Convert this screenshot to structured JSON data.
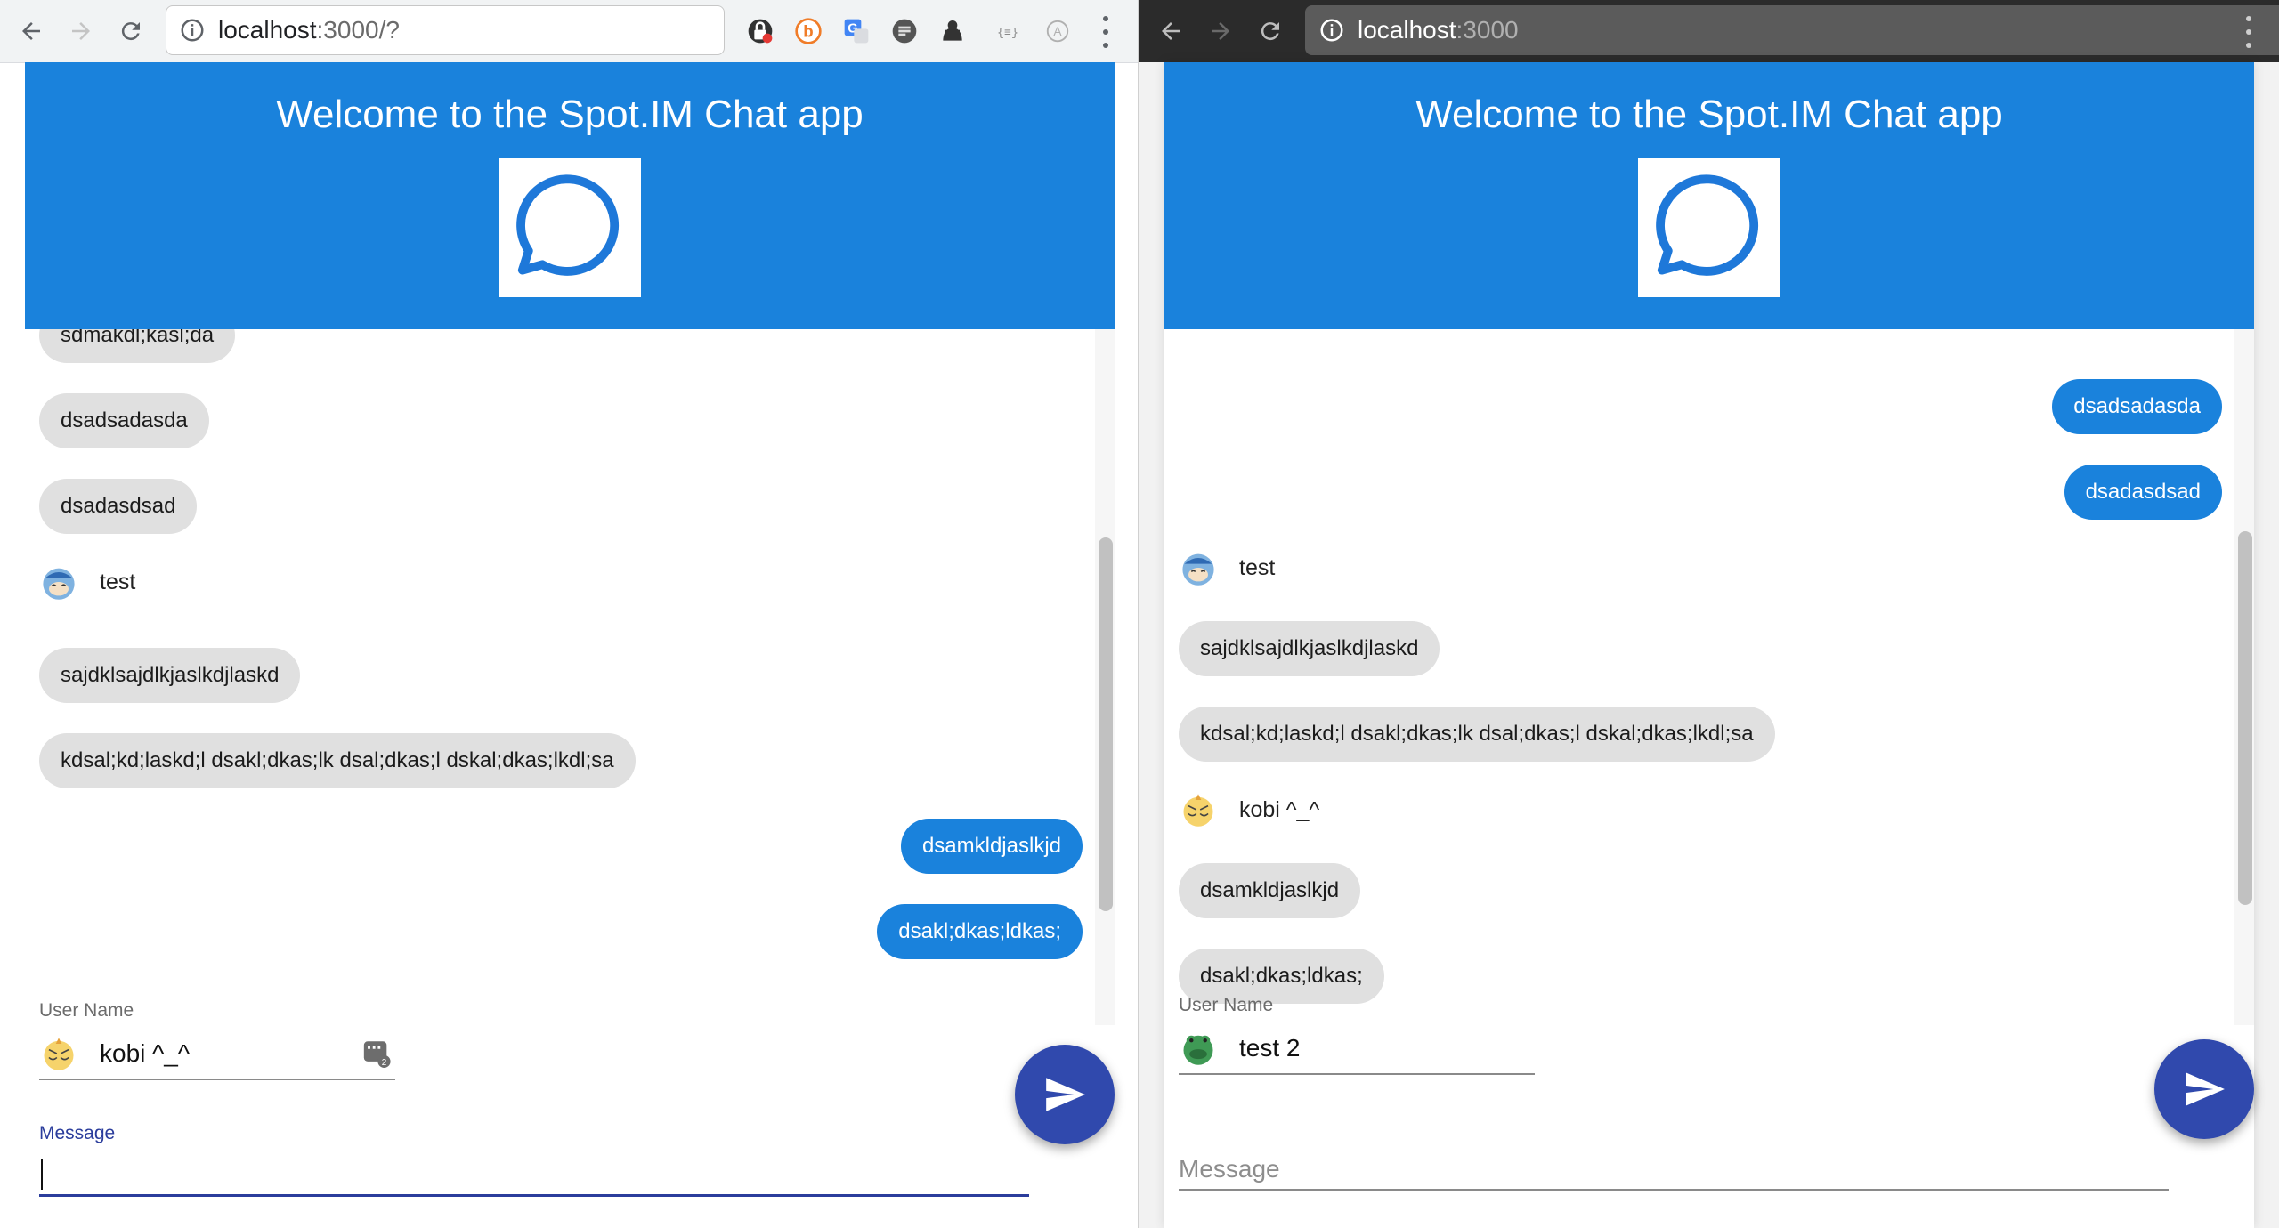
{
  "left": {
    "url_host": "localhost",
    "url_rest": ":3000/?",
    "app_title": "Welcome to the Spot.IM Chat app",
    "messages_top": [
      {
        "text": "sdmakdl;kasl;da"
      },
      {
        "text": "dsadsadasda"
      },
      {
        "text": "dsadasdsad"
      }
    ],
    "author": "test",
    "messages_mid": [
      {
        "text": "sajdklsajdlkjaslkdjlaskd"
      },
      {
        "text": "kdsal;kd;laskd;l dsakl;dkas;lk dsal;dkas;l dskal;dkas;lkdl;sa"
      }
    ],
    "messages_out": [
      {
        "text": "dsamkldjaslkjd"
      },
      {
        "text": "dsakl;dkas;ldkas;"
      }
    ],
    "user_name_label": "User Name",
    "user_name_value": "kobi ^_^",
    "message_label": "Message",
    "scroll_position": 0.62
  },
  "right": {
    "url_host": "localhost",
    "url_rest": ":3000",
    "app_title": "Welcome to the Spot.IM Chat app",
    "messages_out": [
      {
        "text": "dsadsadasda"
      },
      {
        "text": "dsadasdsad"
      }
    ],
    "author1": "test",
    "messages_mid": [
      {
        "text": "sajdklsajdlkjaslkdjlaskd"
      },
      {
        "text": "kdsal;kd;laskd;l dsakl;dkas;lk dsal;dkas;l dskal;dkas;lkdl;sa"
      }
    ],
    "author2": "kobi ^_^",
    "messages_bottom": [
      {
        "text": "dsamkldjaslkjd"
      },
      {
        "text": "dsakl;dkas;ldkas;"
      }
    ],
    "user_name_label": "User Name",
    "user_name_value": "test 2",
    "message_placeholder": "Message",
    "scroll_position": 0.6
  },
  "colors": {
    "header_blue": "#1a82dc",
    "fab_indigo": "#3049ad",
    "bubble_gray": "#e0e0e0"
  },
  "icons": [
    "back-arrow-icon",
    "forward-arrow-icon",
    "reload-icon",
    "info-icon",
    "chat-bubble-logo-icon",
    "send-icon",
    "cat-avatar-icon",
    "chick-avatar-icon",
    "frog-avatar-icon",
    "keyboard-icon",
    "kebab-menu-icon"
  ]
}
